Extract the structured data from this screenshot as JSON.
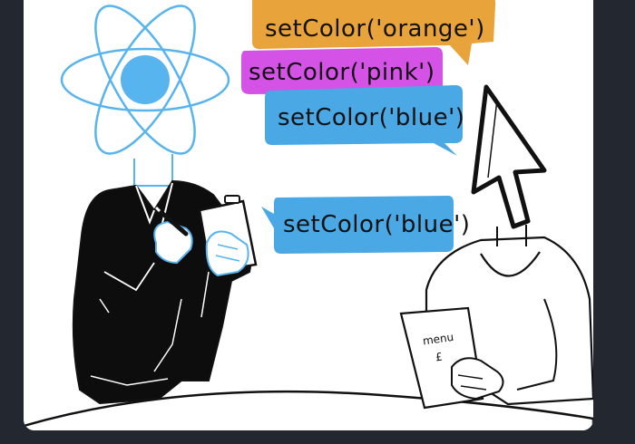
{
  "colors": {
    "page_background": "#23272f",
    "panel_background": "#ffffff",
    "react_blue": "#58b4ee",
    "bubble_orange": "#e8a33a",
    "bubble_pink": "#d452e6",
    "bubble_blue": "#4aa8e4",
    "ink": "#111111"
  },
  "bubbles": {
    "orange": "setColor('orange')",
    "pink": "setColor('pink')",
    "blue": "setColor('blue')",
    "waiter_blue": "setColor('blue')"
  },
  "menu": {
    "title": "menu",
    "symbol": "£"
  },
  "icons": {
    "head_left": "react-atom-icon",
    "head_right": "cursor-arrow-icon"
  }
}
